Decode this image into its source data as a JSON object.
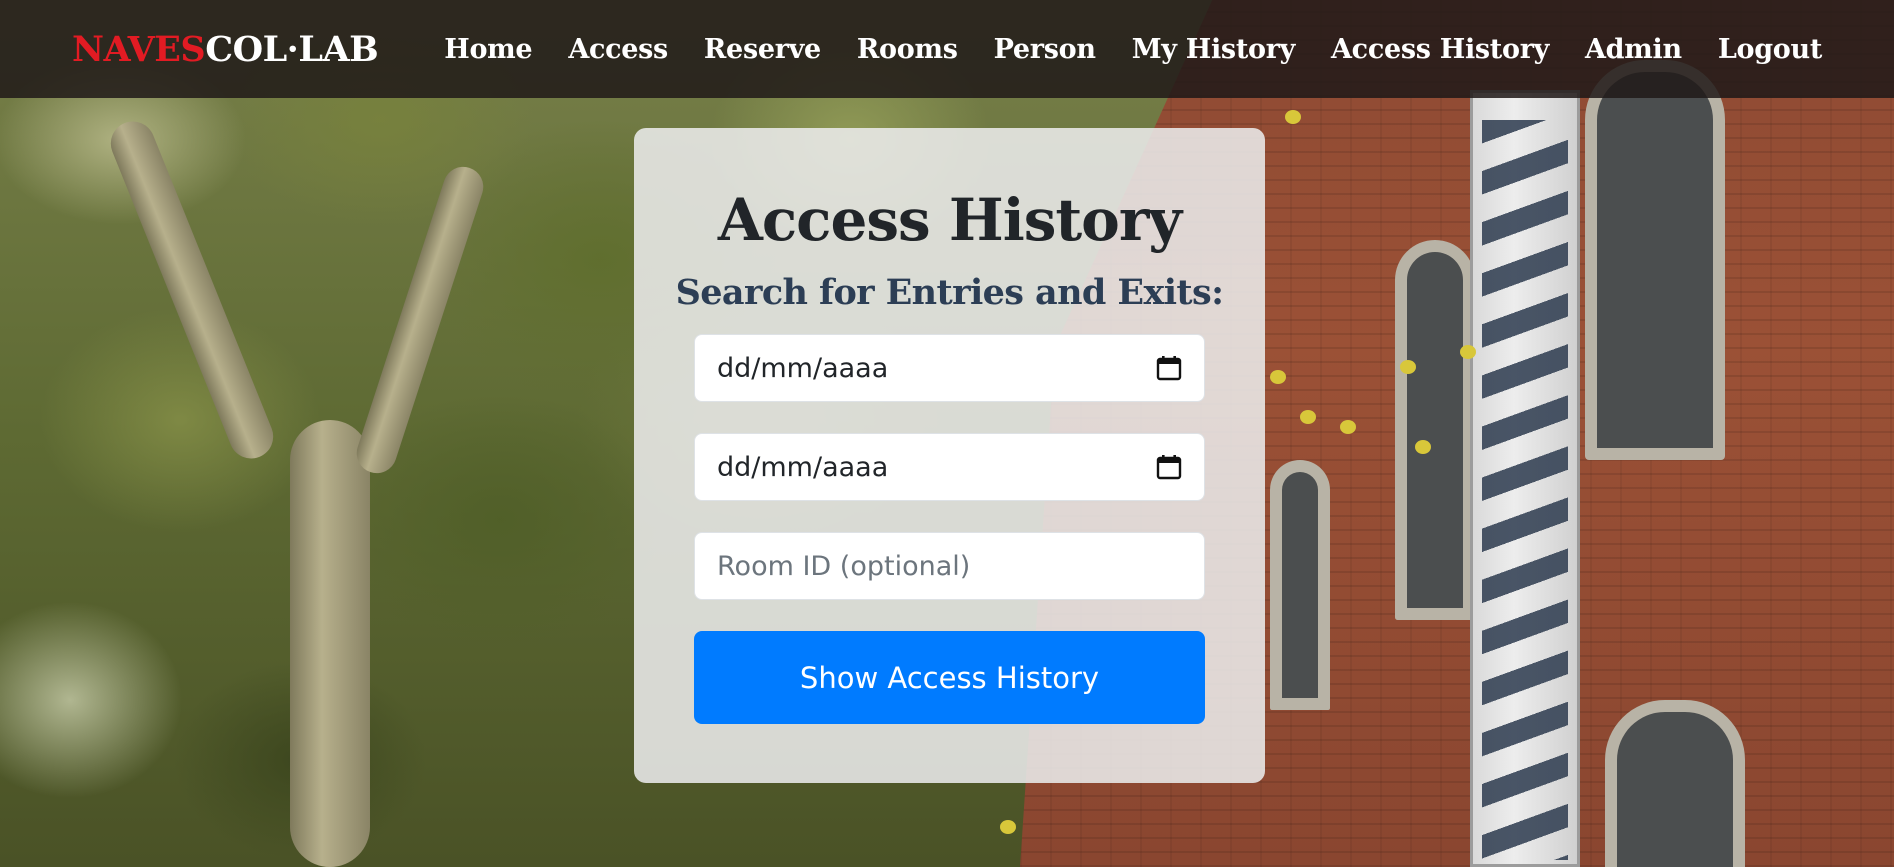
{
  "brand": {
    "part_red": "NAVES",
    "part_white": "COL·LAB",
    "red_color": "#e21b23"
  },
  "nav": {
    "items": [
      {
        "label": "Home"
      },
      {
        "label": "Access"
      },
      {
        "label": "Reserve"
      },
      {
        "label": "Rooms"
      },
      {
        "label": "Person"
      },
      {
        "label": "My History"
      },
      {
        "label": "Access History"
      },
      {
        "label": "Admin"
      },
      {
        "label": "Logout"
      }
    ]
  },
  "form": {
    "title": "Access History",
    "subtitle": "Search for Entries and Exits:",
    "start_date": {
      "value": "dd/mm/aaaa",
      "icon": "calendar-icon"
    },
    "end_date": {
      "value": "dd/mm/aaaa",
      "icon": "calendar-icon"
    },
    "room_id": {
      "placeholder": "Room ID (optional)",
      "value": ""
    },
    "submit_label": "Show Access History",
    "submit_color": "#007bff"
  }
}
